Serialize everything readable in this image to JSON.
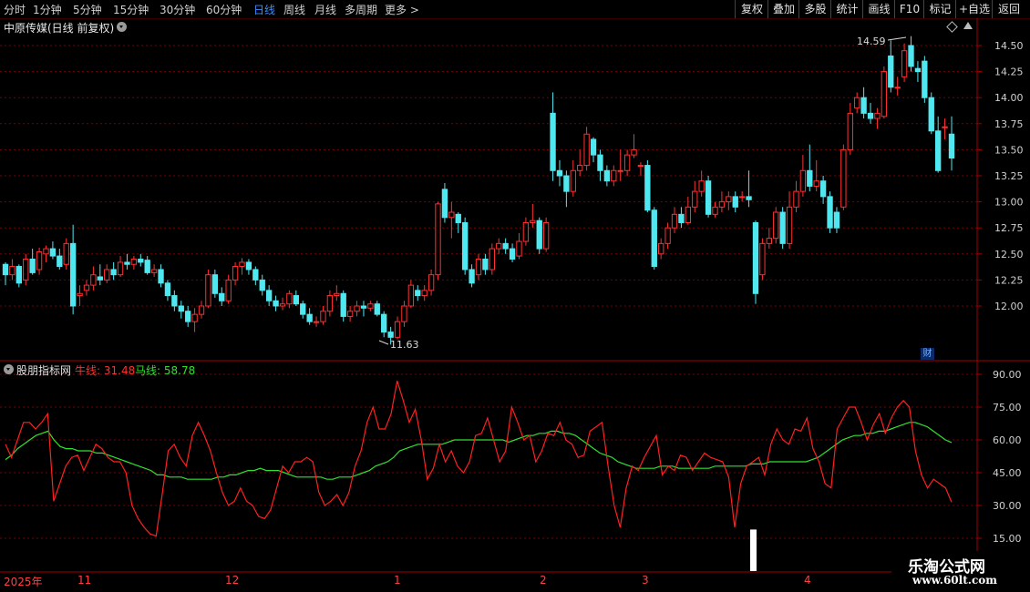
{
  "toolbar": {
    "periods": [
      "分时",
      "1分钟",
      "5分钟",
      "15分钟",
      "30分钟",
      "60分钟",
      "日线",
      "周线",
      "月线",
      "多周期",
      "更多 >"
    ],
    "active_period": "日线",
    "buttons": [
      "复权",
      "叠加",
      "多股",
      "统计",
      "画线",
      "F10",
      "标记",
      "+自选",
      "返回"
    ]
  },
  "main_chart": {
    "title": "中原传媒(日线 前复权)",
    "price_ticks": [
      "14.50",
      "14.25",
      "14.00",
      "13.75",
      "13.50",
      "13.25",
      "13.00",
      "12.75",
      "12.50",
      "12.25",
      "12.00"
    ],
    "high_label": "14.59",
    "low_label": "11.63",
    "finance_badge": "财",
    "candles": [
      [
        12.4,
        12.3,
        12.42,
        12.2
      ],
      [
        12.3,
        12.38,
        12.45,
        12.25
      ],
      [
        12.38,
        12.22,
        12.4,
        12.18
      ],
      [
        12.25,
        12.45,
        12.5,
        12.2
      ],
      [
        12.45,
        12.32,
        12.55,
        12.3
      ],
      [
        12.35,
        12.52,
        12.56,
        12.3
      ],
      [
        12.5,
        12.55,
        12.58,
        12.42
      ],
      [
        12.55,
        12.48,
        12.62,
        12.45
      ],
      [
        12.48,
        12.38,
        12.55,
        12.35
      ],
      [
        12.4,
        12.6,
        12.65,
        12.35
      ],
      [
        12.6,
        12.0,
        12.78,
        11.92
      ],
      [
        12.1,
        12.12,
        12.2,
        12.0
      ],
      [
        12.15,
        12.2,
        12.25,
        12.1
      ],
      [
        12.2,
        12.3,
        12.38,
        12.15
      ],
      [
        12.28,
        12.25,
        12.4,
        12.2
      ],
      [
        12.25,
        12.35,
        12.4,
        12.22
      ],
      [
        12.35,
        12.3,
        12.42,
        12.25
      ],
      [
        12.3,
        12.42,
        12.48,
        12.28
      ],
      [
        12.42,
        12.4,
        12.5,
        12.35
      ],
      [
        12.4,
        12.45,
        12.48,
        12.35
      ],
      [
        12.45,
        12.42,
        12.5,
        12.38
      ],
      [
        12.44,
        12.32,
        12.48,
        12.3
      ],
      [
        12.32,
        12.35,
        12.4,
        12.28
      ],
      [
        12.35,
        12.22,
        12.4,
        12.18
      ],
      [
        12.22,
        12.1,
        12.25,
        12.05
      ],
      [
        12.1,
        12.0,
        12.15,
        11.95
      ],
      [
        12.0,
        11.95,
        12.05,
        11.88
      ],
      [
        11.95,
        11.85,
        12.0,
        11.8
      ],
      [
        11.85,
        11.92,
        11.98,
        11.75
      ],
      [
        11.92,
        12.0,
        12.05,
        11.88
      ],
      [
        12.0,
        12.3,
        12.35,
        11.98
      ],
      [
        12.3,
        12.12,
        12.35,
        12.08
      ],
      [
        12.12,
        12.05,
        12.18,
        12.0
      ],
      [
        12.05,
        12.25,
        12.3,
        12.02
      ],
      [
        12.25,
        12.38,
        12.42,
        12.2
      ],
      [
        12.38,
        12.42,
        12.46,
        12.3
      ],
      [
        12.42,
        12.35,
        12.45,
        12.3
      ],
      [
        12.35,
        12.25,
        12.38,
        12.2
      ],
      [
        12.25,
        12.15,
        12.3,
        12.1
      ],
      [
        12.15,
        12.05,
        12.2,
        12.0
      ],
      [
        12.05,
        12.0,
        12.1,
        11.95
      ],
      [
        12.0,
        12.02,
        12.08,
        11.96
      ],
      [
        12.02,
        12.12,
        12.15,
        11.98
      ],
      [
        12.1,
        12.02,
        12.15,
        12.0
      ],
      [
        12.02,
        11.92,
        12.05,
        11.88
      ],
      [
        11.92,
        11.85,
        11.98,
        11.82
      ],
      [
        11.85,
        11.85,
        11.9,
        11.8
      ],
      [
        11.85,
        11.95,
        12.0,
        11.82
      ],
      [
        11.95,
        12.1,
        12.15,
        11.9
      ],
      [
        12.1,
        12.12,
        12.2,
        12.05
      ],
      [
        12.12,
        11.9,
        12.15,
        11.85
      ],
      [
        11.9,
        11.95,
        12.0,
        11.85
      ],
      [
        11.95,
        12.0,
        12.05,
        11.9
      ],
      [
        12.0,
        11.98,
        12.05,
        11.9
      ],
      [
        11.98,
        12.02,
        12.05,
        11.95
      ],
      [
        12.02,
        11.92,
        12.05,
        11.9
      ],
      [
        11.92,
        11.75,
        11.95,
        11.7
      ],
      [
        11.75,
        11.7,
        11.8,
        11.63
      ],
      [
        11.7,
        11.85,
        11.9,
        11.68
      ],
      [
        11.85,
        12.0,
        12.05,
        11.8
      ],
      [
        12.0,
        12.2,
        12.25,
        11.98
      ],
      [
        12.15,
        12.1,
        12.2,
        12.05
      ],
      [
        12.1,
        12.15,
        12.2,
        12.05
      ],
      [
        12.15,
        12.3,
        12.35,
        12.1
      ],
      [
        12.3,
        12.98,
        13.0,
        12.25
      ],
      [
        13.12,
        12.85,
        13.18,
        12.8
      ],
      [
        12.85,
        12.9,
        13.0,
        12.65
      ],
      [
        12.88,
        12.8,
        12.9,
        12.7
      ],
      [
        12.8,
        12.35,
        12.85,
        12.3
      ],
      [
        12.35,
        12.22,
        12.4,
        12.18
      ],
      [
        12.3,
        12.45,
        12.5,
        12.25
      ],
      [
        12.45,
        12.35,
        12.5,
        12.3
      ],
      [
        12.35,
        12.55,
        12.6,
        12.3
      ],
      [
        12.55,
        12.6,
        12.65,
        12.5
      ],
      [
        12.6,
        12.55,
        12.65,
        12.5
      ],
      [
        12.55,
        12.45,
        12.6,
        12.42
      ],
      [
        12.48,
        12.62,
        12.7,
        12.45
      ],
      [
        12.62,
        12.8,
        12.85,
        12.58
      ],
      [
        12.8,
        12.82,
        12.98,
        12.75
      ],
      [
        12.82,
        12.55,
        12.85,
        12.5
      ],
      [
        12.55,
        12.8,
        12.85,
        12.52
      ],
      [
        13.85,
        13.3,
        14.05,
        13.2
      ],
      [
        13.3,
        13.25,
        13.4,
        13.15
      ],
      [
        13.25,
        13.1,
        13.3,
        12.95
      ],
      [
        13.1,
        13.3,
        13.4,
        13.05
      ],
      [
        13.3,
        13.35,
        13.5,
        13.25
      ],
      [
        13.35,
        13.65,
        13.72,
        13.3
      ],
      [
        13.6,
        13.45,
        13.62,
        13.38
      ],
      [
        13.45,
        13.3,
        13.5,
        13.2
      ],
      [
        13.3,
        13.2,
        13.35,
        13.15
      ],
      [
        13.2,
        13.3,
        13.35,
        13.15
      ],
      [
        13.3,
        13.3,
        13.5,
        13.2
      ],
      [
        13.3,
        13.45,
        13.5,
        13.25
      ],
      [
        13.45,
        13.5,
        13.65,
        13.42
      ],
      [
        13.35,
        13.35,
        13.38,
        13.25
      ],
      [
        13.35,
        12.92,
        13.4,
        12.9
      ],
      [
        12.92,
        12.38,
        12.95,
        12.35
      ],
      [
        12.5,
        12.6,
        12.65,
        12.45
      ],
      [
        12.6,
        12.75,
        12.8,
        12.55
      ],
      [
        12.75,
        12.88,
        12.95,
        12.7
      ],
      [
        12.88,
        12.8,
        12.95,
        12.75
      ],
      [
        12.8,
        12.95,
        13.05,
        12.78
      ],
      [
        12.95,
        13.1,
        13.2,
        12.9
      ],
      [
        13.1,
        13.2,
        13.3,
        13.05
      ],
      [
        13.2,
        12.88,
        13.25,
        12.85
      ],
      [
        12.88,
        12.95,
        13.0,
        12.85
      ],
      [
        12.95,
        13.0,
        13.1,
        12.9
      ],
      [
        13.0,
        13.05,
        13.1,
        12.92
      ],
      [
        13.05,
        12.95,
        13.1,
        12.9
      ],
      [
        13.05,
        13.05,
        13.1,
        13.0
      ],
      [
        13.05,
        13.02,
        13.3,
        12.95
      ],
      [
        12.8,
        12.12,
        12.82,
        12.02
      ],
      [
        12.3,
        12.6,
        12.65,
        12.25
      ],
      [
        12.6,
        12.65,
        12.75,
        12.55
      ],
      [
        12.65,
        12.9,
        12.95,
        12.6
      ],
      [
        12.9,
        12.6,
        12.95,
        12.55
      ],
      [
        12.6,
        12.95,
        13.1,
        12.55
      ],
      [
        12.95,
        13.1,
        13.2,
        12.9
      ],
      [
        13.1,
        13.3,
        13.45,
        13.05
      ],
      [
        13.3,
        13.15,
        13.55,
        13.1
      ],
      [
        13.15,
        13.2,
        13.4,
        13.1
      ],
      [
        13.2,
        13.05,
        13.25,
        12.98
      ],
      [
        13.05,
        12.75,
        13.1,
        12.7
      ],
      [
        12.9,
        12.75,
        12.95,
        12.7
      ],
      [
        12.95,
        13.5,
        13.55,
        12.92
      ],
      [
        13.5,
        13.85,
        13.95,
        13.45
      ],
      [
        13.9,
        14.0,
        14.05,
        13.85
      ],
      [
        14.0,
        13.85,
        14.1,
        13.8
      ],
      [
        13.85,
        13.8,
        13.95,
        13.75
      ],
      [
        13.8,
        13.85,
        13.9,
        13.7
      ],
      [
        13.82,
        14.25,
        14.3,
        13.8
      ],
      [
        14.4,
        14.1,
        14.55,
        14.05
      ],
      [
        14.1,
        14.1,
        14.2,
        14.02
      ],
      [
        14.2,
        14.45,
        14.52,
        14.15
      ],
      [
        14.5,
        14.3,
        14.59,
        14.25
      ],
      [
        14.28,
        14.25,
        14.35,
        14.15
      ],
      [
        14.35,
        14.0,
        14.4,
        13.95
      ],
      [
        14.0,
        13.68,
        14.05,
        13.65
      ],
      [
        13.68,
        13.3,
        13.82,
        13.28
      ],
      [
        13.72,
        13.72,
        13.8,
        13.6
      ],
      [
        13.65,
        13.42,
        13.82,
        13.3
      ]
    ]
  },
  "indicator": {
    "title": "股朋指标网",
    "bull_label": "牛线: 31.48",
    "horse_label": "马线: 58.78",
    "ticks": [
      "90.00",
      "75.00",
      "60.00",
      "45.00",
      "30.00",
      "15.00"
    ],
    "bull_series": [
      58,
      52,
      60,
      68,
      68,
      65,
      68,
      72,
      32,
      40,
      48,
      52,
      53,
      46,
      52,
      58,
      56,
      52,
      50,
      50,
      45,
      30,
      24,
      20,
      17,
      16,
      35,
      55,
      58,
      52,
      48,
      62,
      68,
      62,
      55,
      45,
      36,
      30,
      32,
      38,
      32,
      30,
      25,
      24,
      28,
      38,
      48,
      45,
      50,
      50,
      52,
      50,
      36,
      30,
      32,
      35,
      30,
      36,
      48,
      55,
      68,
      75,
      65,
      65,
      72,
      87,
      78,
      68,
      74,
      60,
      42,
      47,
      58,
      50,
      55,
      48,
      45,
      50,
      62,
      63,
      70,
      60,
      50,
      55,
      75,
      68,
      60,
      62,
      50,
      55,
      63,
      62,
      68,
      60,
      58,
      52,
      53,
      64,
      66,
      68,
      48,
      30,
      20,
      38,
      48,
      46,
      52,
      57,
      62,
      44,
      48,
      46,
      53,
      52,
      46,
      50,
      54,
      52,
      51,
      50,
      43,
      20,
      40,
      48,
      50,
      52,
      44,
      58,
      65,
      60,
      58,
      65,
      64,
      70,
      56,
      50,
      40,
      38,
      65,
      70,
      75,
      75,
      68,
      60,
      67,
      72,
      63,
      70,
      75,
      78,
      75,
      55,
      44,
      38,
      42,
      40,
      38,
      31.48
    ],
    "horse_series": [
      51,
      53,
      56,
      58,
      60,
      62,
      63,
      64,
      60,
      57,
      56,
      56,
      55,
      55,
      55,
      54,
      54,
      53,
      52,
      51,
      50,
      49,
      48,
      47,
      46,
      44,
      44,
      43,
      43,
      43,
      42,
      42,
      42,
      42,
      42,
      43,
      43,
      44,
      44,
      45,
      46,
      46,
      47,
      46,
      46,
      46,
      45,
      44,
      43,
      43,
      43,
      43,
      43,
      42,
      42,
      43,
      43,
      43,
      44,
      45,
      46,
      48,
      49,
      50,
      52,
      55,
      56,
      57,
      58,
      58,
      58,
      58,
      58,
      59,
      60,
      60,
      60,
      60,
      60,
      60,
      60,
      60,
      60,
      59,
      60,
      61,
      62,
      62,
      63,
      63,
      64,
      64,
      63,
      63,
      62,
      60,
      58,
      56,
      54,
      53,
      52,
      50,
      49,
      48,
      47,
      47,
      47,
      47,
      48,
      48,
      48,
      47,
      47,
      47,
      47,
      47,
      47,
      48,
      48,
      48,
      48,
      48,
      48,
      49,
      49,
      49,
      50,
      50,
      50,
      50,
      50,
      50,
      50,
      51,
      52,
      54,
      56,
      58,
      60,
      61,
      62,
      62,
      63,
      63,
      64,
      64,
      65,
      66,
      67,
      68,
      68,
      67,
      66,
      64,
      62,
      60,
      58.78
    ],
    "spike_value": 19
  },
  "dates": {
    "labels": [
      "2025年",
      "11",
      "12",
      "1",
      "2",
      "3",
      "4"
    ]
  },
  "watermark": {
    "line1": "乐淘公式网",
    "line2": "www.60lt.com"
  }
}
